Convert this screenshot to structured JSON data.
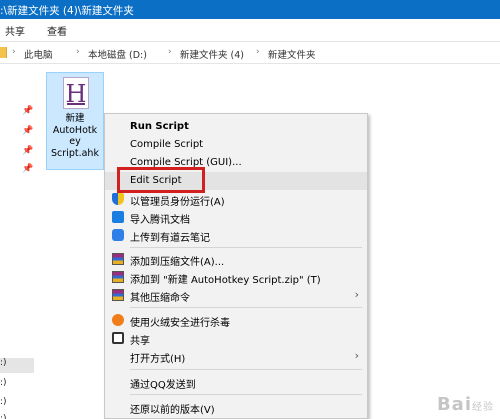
{
  "window": {
    "title": ":\\新建文件夹 (4)\\新建文件夹"
  },
  "ribbon": {
    "tabs": [
      "共享",
      "查看"
    ]
  },
  "address": {
    "breadcrumbs": [
      "此电脑",
      "本地磁盘 (D:)",
      "新建文件夹 (4)",
      "新建文件夹"
    ]
  },
  "navpane": {
    "drives": [
      ":)",
      ":)",
      ":)",
      ":)"
    ]
  },
  "file": {
    "name": "新建\nAutoHotk\ney\nScript.ahk",
    "icon": "autohotkey-file-icon"
  },
  "context_menu": {
    "items": [
      {
        "label": "Run Script",
        "bold": true
      },
      {
        "label": "Compile Script"
      },
      {
        "label": "Compile Script (GUI)..."
      },
      {
        "label": "Edit Script",
        "highlighted": true
      },
      {
        "label": "以管理员身份运行(A)",
        "icon": "uac-shield-icon"
      },
      {
        "label": "导入腾讯文档",
        "icon": "tencent-docs-icon"
      },
      {
        "label": "上传到有道云笔记",
        "icon": "youdao-note-icon"
      },
      {
        "label": "添加到压缩文件(A)...",
        "icon": "winrar-icon"
      },
      {
        "label": "添加到 \"新建 AutoHotkey Script.zip\" (T)",
        "icon": "winrar-icon"
      },
      {
        "label": "其他压缩命令",
        "icon": "winrar-icon",
        "submenu": true
      },
      {
        "label": "使用火绒安全进行杀毒",
        "icon": "huorong-icon"
      },
      {
        "label": "共享",
        "icon": "share-icon"
      },
      {
        "label": "打开方式(H)",
        "submenu": true
      },
      {
        "label": "通过QQ发送到"
      },
      {
        "label": "还原以前的版本(V)"
      }
    ]
  },
  "watermark": {
    "text": "Bai",
    "sub": "经验"
  },
  "colors": {
    "titlebar": "#0b6fc6",
    "selection": "#cce8ff",
    "highlight_box": "#d22020",
    "menu_bg": "#f2f2f2"
  }
}
